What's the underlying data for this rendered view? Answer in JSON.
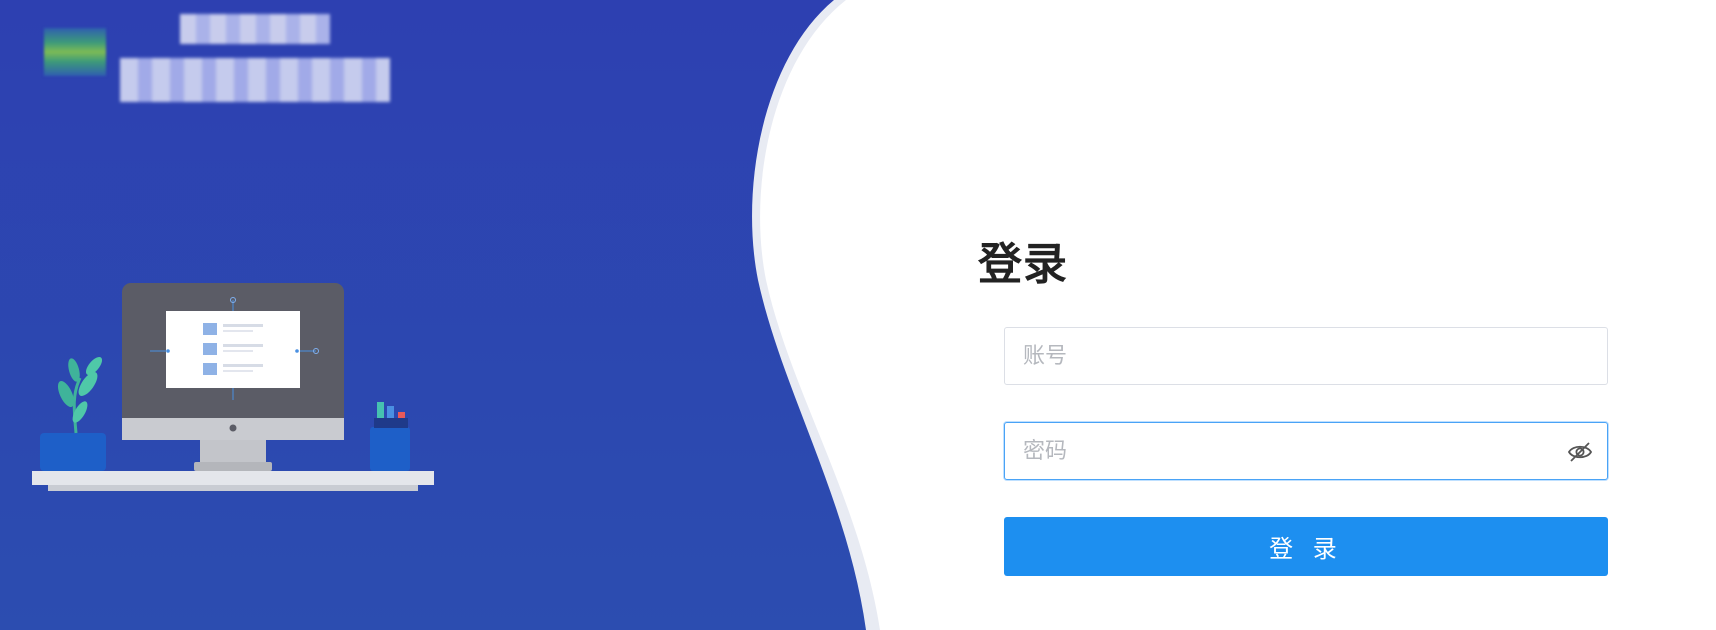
{
  "brand": {
    "logo_icon": "app-logo-icon",
    "title_line1": "",
    "title_line2": ""
  },
  "illustration": {
    "name": "desk-computer-illustration",
    "icons": [
      "monitor-icon",
      "plant-icon",
      "pen-holder-icon"
    ]
  },
  "login": {
    "title": "登录",
    "username_placeholder": "账号",
    "username_value": "",
    "password_placeholder": "密码",
    "password_value": "",
    "password_toggle_icon": "eye-slash-icon",
    "submit_label": "登 录"
  },
  "colors": {
    "left_panel": "#2d43b3",
    "primary_button": "#1d8ff0",
    "focus_border": "#4aa3f6",
    "title_text": "#222222"
  }
}
